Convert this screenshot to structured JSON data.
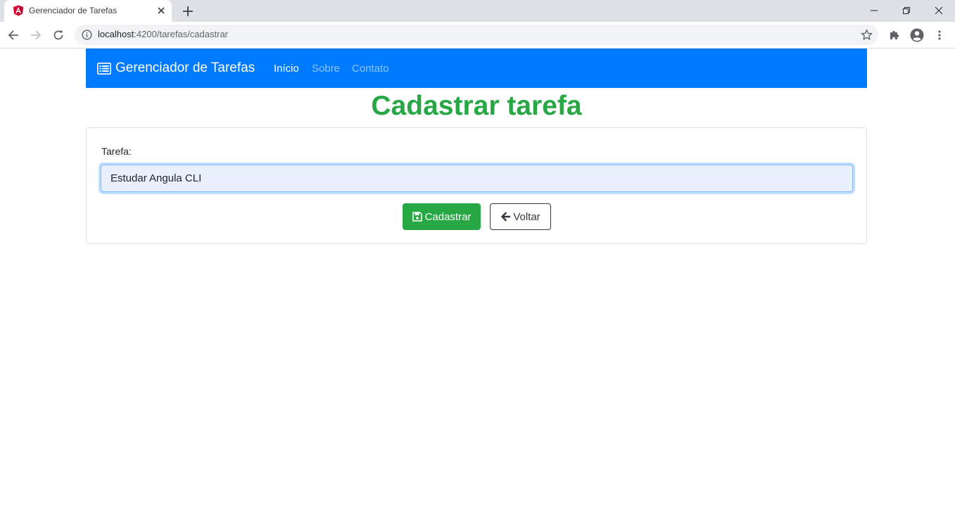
{
  "browser": {
    "tab_title": "Gerenciador de Tarefas",
    "url_host": "localhost",
    "url_path": ":4200/tarefas/cadastrar"
  },
  "navbar": {
    "brand": "Gerenciador de Tarefas",
    "links": [
      {
        "label": "Início",
        "active": true
      },
      {
        "label": "Sobre",
        "active": false
      },
      {
        "label": "Contato",
        "active": false
      }
    ]
  },
  "page": {
    "title": "Cadastrar tarefa"
  },
  "form": {
    "label": "Tarefa:",
    "input_value": "Estudar Angula CLI",
    "submit_label": "Cadastrar",
    "back_label": "Voltar"
  },
  "colors": {
    "navbar": "#007bff",
    "title": "#28a745",
    "submit": "#28a745"
  },
  "icons": {
    "favicon": "angular-icon",
    "brand": "list-alt-icon",
    "submit": "save-icon",
    "back": "arrow-left-icon"
  }
}
